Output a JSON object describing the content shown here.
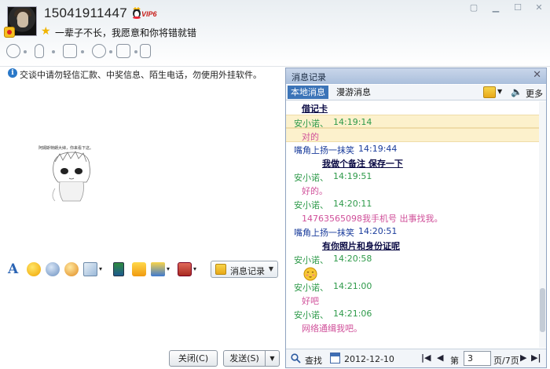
{
  "profile": {
    "nickname": "15041911447",
    "vip_label": "VIP6",
    "signature": "一辈子不长，我愿意和你将错就错"
  },
  "notice": {
    "text": "交谈中请勿轻信汇款、中奖信息、陌生电话，勿使用外挂软件。"
  },
  "sticker": {
    "caption": "阿姆斯特朗大婶，你来看下这。"
  },
  "input_toolbar": {
    "history_button_label": "消息记录"
  },
  "buttons": {
    "close_label": "关闭(C)",
    "send_label": "发送(S)"
  },
  "history_panel": {
    "title": "消息记录",
    "tabs": [
      {
        "label": "本地消息",
        "active": true
      },
      {
        "label": "漫游消息",
        "active": false
      }
    ],
    "more_label": "更多",
    "messages": [
      {
        "type": "note",
        "text": "借记卡"
      },
      {
        "type": "header",
        "sender": "安小诺、",
        "time": "14:19:14",
        "highlight": true
      },
      {
        "type": "body",
        "text": "对的",
        "highlight": true
      },
      {
        "type": "header",
        "sender": "嘴角上扬一抹笑",
        "time": "14:19:44",
        "self": true
      },
      {
        "type": "note",
        "text": "我做个备注 保存一下"
      },
      {
        "type": "header",
        "sender": "安小诺、",
        "time": "14:19:51"
      },
      {
        "type": "body",
        "text": "好的。"
      },
      {
        "type": "header",
        "sender": "安小诺、",
        "time": "14:20:11"
      },
      {
        "type": "body",
        "text": "14763565098我手机号  出事找我。"
      },
      {
        "type": "header",
        "sender": "嘴角上扬一抹笑",
        "time": "14:20:51",
        "self": true
      },
      {
        "type": "note",
        "text": "有你照片和身份证呢"
      },
      {
        "type": "header",
        "sender": "安小诺、",
        "time": "14:20:58"
      },
      {
        "type": "emoji",
        "icon": "shy-face-icon"
      },
      {
        "type": "header",
        "sender": "安小诺、",
        "time": "14:21:00"
      },
      {
        "type": "body",
        "text": "好吧"
      },
      {
        "type": "header",
        "sender": "安小诺、",
        "time": "14:21:06"
      },
      {
        "type": "body",
        "text": "网络通缉我吧。"
      }
    ],
    "footer": {
      "search_label": "查找",
      "date": "2012-12-10",
      "page_prefix": "第",
      "current_page": "3",
      "page_suffix": "页/7页"
    }
  },
  "colors": {
    "other_sender": "#2e9a4a",
    "self_sender": "#1a3c9c",
    "other_text": "#d0509a",
    "note_text": "#0a0a44",
    "highlight": "#fcf1cc"
  }
}
